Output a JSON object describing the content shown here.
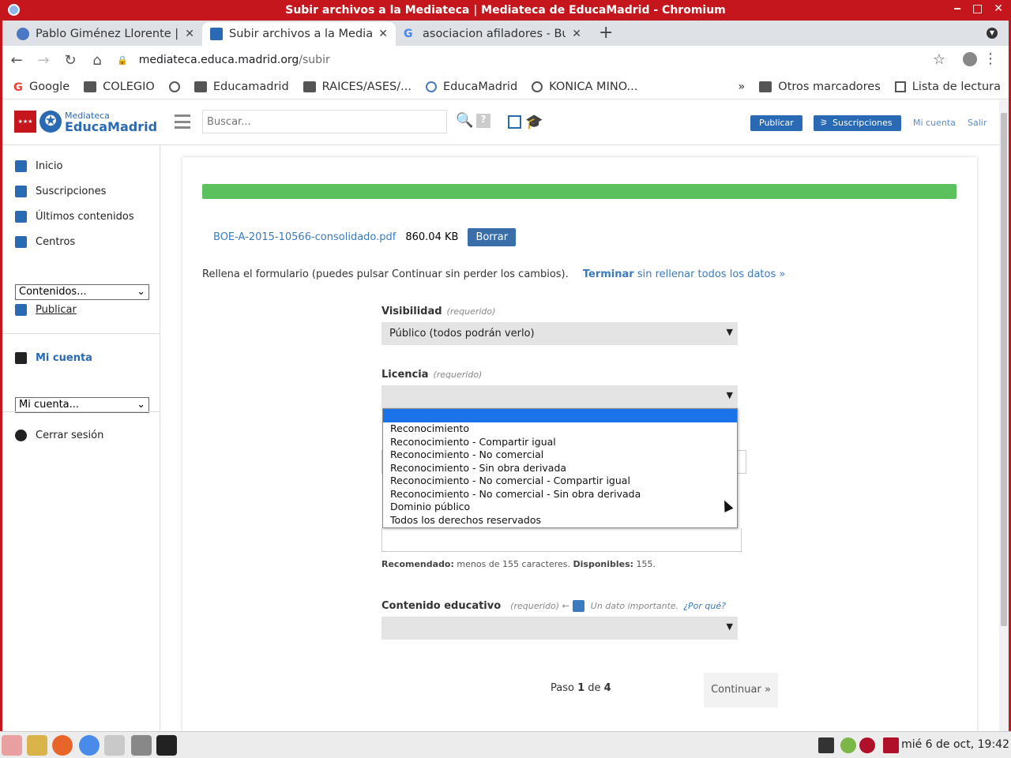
{
  "window": {
    "title": "Subir archivos a la Mediateca | Mediateca de EducaMadrid - Chromium",
    "controls": [
      "‒",
      "□",
      "✕"
    ]
  },
  "tabs": [
    {
      "label": "Pablo Giménez Llorente | ",
      "icon": "educamadrid-icon"
    },
    {
      "label": "Subir archivos a la Mediat",
      "icon": "mediateca-icon"
    },
    {
      "label": "asociacion afiladores - Bu",
      "icon": "google-icon"
    }
  ],
  "browser": {
    "url_host": "mediateca.educa.madrid.org",
    "url_path": "/subir",
    "bookmarks": [
      "Google",
      "COLEGIO",
      "",
      "Educamadrid",
      "RAICES/ASES/...",
      "EducaMadrid",
      "KONICA MINO..."
    ],
    "bookmarks_right": [
      "»",
      "Otros marcadores",
      "Lista de lectura"
    ]
  },
  "header": {
    "logo_small": "Mediateca",
    "logo_big": "EducaMadrid",
    "search_placeholder": "Buscar...",
    "publicar": "Publicar",
    "suscripciones": "Suscripciones",
    "mi_cuenta": "Mi cuenta",
    "salir": "Salir"
  },
  "sidebar": {
    "items": [
      "Inicio",
      "Suscripciones",
      "Últimos contenidos",
      "Centros"
    ],
    "contenidos_select": "Contenidos...",
    "publicar": "Publicar",
    "mi_cuenta": "Mi cuenta",
    "mi_cuenta_select": "Mi cuenta...",
    "cerrar": "Cerrar sesión"
  },
  "upload": {
    "progress_percent": 100,
    "file_name": "BOE-A-2015-10566-consolidado.pdf",
    "file_size": "860.04 KB",
    "borrar": "Borrar",
    "instructions": "Rellena el formulario (puedes pulsar Continuar sin perder los cambios).",
    "terminar_bold": "Terminar",
    "terminar_rest": " sin rellenar todos los datos »"
  },
  "form": {
    "visibilidad_label": "Visibilidad",
    "required": "(requerido)",
    "visibilidad_value": "Público (todos podrán verlo)",
    "licencia_label": "Licencia",
    "licencia_value": "",
    "licencia_options": [
      "",
      "Reconocimiento",
      "Reconocimiento - Compartir igual",
      "Reconocimiento - No comercial",
      "Reconocimiento - Sin obra derivada",
      "Reconocimiento - No comercial - Compartir igual",
      "Reconocimiento - No comercial - Sin obra derivada",
      "Dominio público",
      "Todos los derechos reservados"
    ],
    "hint_rec_label": "Recomendado:",
    "hint_rec_text": " menos de 155 caracteres. ",
    "hint_disp_label": "Disponibles:",
    "hint_disp_value": " 155.",
    "educativo_label": "Contenido educativo",
    "educativo_req": "(requerido) ←",
    "educativo_important": "Un dato importante.",
    "educativo_why": "¿Por qué?",
    "educativo_value": ""
  },
  "footer": {
    "paso": "Paso ",
    "current": "1",
    "de": " de ",
    "total": "4",
    "continuar": "Continuar »"
  },
  "taskbar": {
    "clock": "mié  6 de oct, 19:42"
  }
}
